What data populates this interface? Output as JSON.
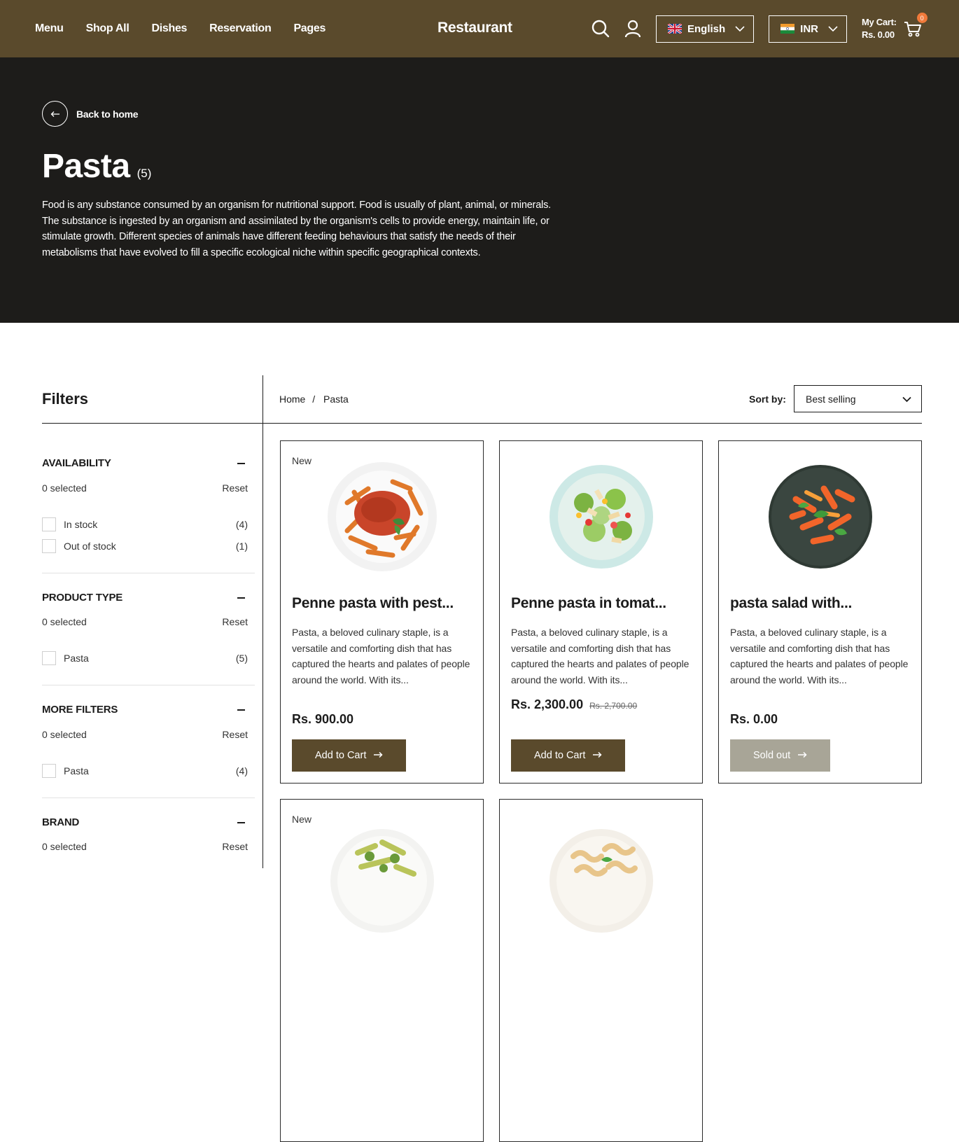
{
  "header": {
    "nav": [
      "Menu",
      "Shop All",
      "Dishes",
      "Reservation",
      "Pages"
    ],
    "brand": "Restaurant",
    "language": "English",
    "currency": "INR",
    "cart_label": "My Cart:",
    "cart_total": "Rs. 0.00",
    "cart_count": "0",
    "icons": {
      "search": "search-icon",
      "account": "user-icon",
      "cart": "cart-icon"
    }
  },
  "hero": {
    "back_label": "Back to home",
    "title": "Pasta",
    "count": "(5)",
    "description": "Food is any substance consumed by an organism for nutritional support. Food is usually of plant, animal, or minerals. The substance is ingested by an organism and assimilated by the organism's cells to provide energy, maintain life, or stimulate growth. Different species of animals have different feeding behaviours that satisfy the needs of their metabolisms that have evolved to fill a specific ecological niche within specific geographical contexts."
  },
  "filters": {
    "title": "Filters",
    "groups": [
      {
        "name": "AVAILABILITY",
        "selected": "0 selected",
        "reset": "Reset",
        "options": [
          {
            "label": "In stock",
            "count": "(4)"
          },
          {
            "label": "Out of stock",
            "count": "(1)"
          }
        ]
      },
      {
        "name": "PRODUCT TYPE",
        "selected": "0 selected",
        "reset": "Reset",
        "options": [
          {
            "label": "Pasta",
            "count": "(5)"
          }
        ]
      },
      {
        "name": "MORE FILTERS",
        "selected": "0 selected",
        "reset": "Reset",
        "options": [
          {
            "label": "Pasta",
            "count": "(4)"
          }
        ]
      },
      {
        "name": "BRAND",
        "selected": "0 selected",
        "reset": "Reset",
        "options": []
      }
    ]
  },
  "toolbar": {
    "breadcrumb": [
      "Home",
      "/",
      "Pasta"
    ],
    "sort_label": "Sort by:",
    "sort_value": "Best selling"
  },
  "products": [
    {
      "badge": "New",
      "title": "Penne pasta with pest...",
      "desc": "Pasta, a beloved culinary staple, is a versatile and comforting dish that has captured the hearts and palates of people around the world. With its...",
      "price": "Rs. 900.00",
      "old_price": "",
      "button": "Add to Cart",
      "available": true
    },
    {
      "badge": "",
      "title": "Penne pasta in tomat...",
      "desc": "Pasta, a beloved culinary staple, is a versatile and comforting dish that has captured the hearts and palates of people around the world. With its...",
      "price": "Rs. 2,300.00",
      "old_price": "Rs. 2,700.00",
      "button": "Add to Cart",
      "available": true
    },
    {
      "badge": "",
      "title": "pasta salad with...",
      "desc": "Pasta, a beloved culinary staple, is a versatile and comforting dish that has captured the hearts and palates of people around the world. With its...",
      "price": "Rs. 0.00",
      "old_price": "",
      "button": "Sold out",
      "available": false
    },
    {
      "badge": "New"
    },
    {
      "badge": ""
    }
  ]
}
